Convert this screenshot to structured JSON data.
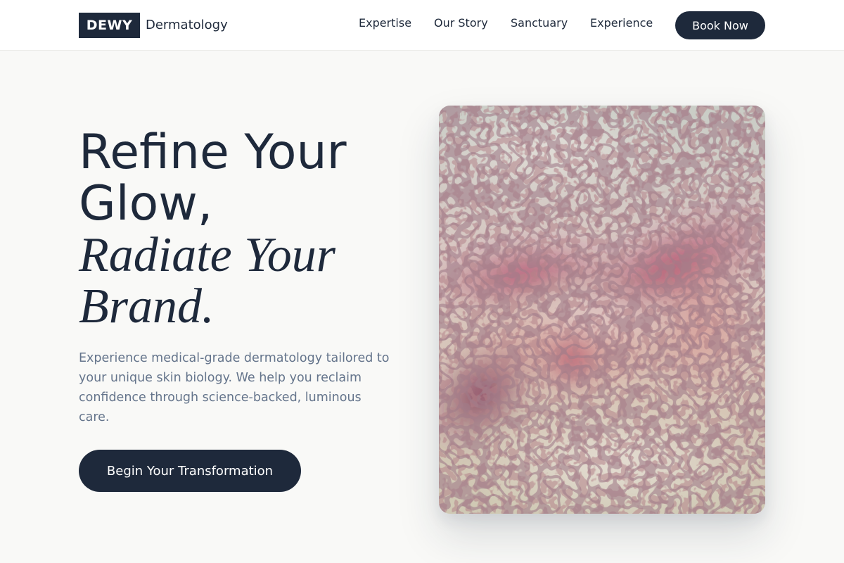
{
  "header": {
    "logo_mark": "DEWY",
    "logo_text": "Dermatology",
    "nav": [
      "Expertise",
      "Our Story",
      "Sanctuary",
      "Experience"
    ],
    "cta": "Book Now"
  },
  "hero": {
    "title_line1": "Refine Your",
    "title_line2": "Glow,",
    "title_line3": "Radiate Your",
    "title_line4": "Brand.",
    "description": "Experience medical-grade dermatology tailored to your unique skin biology. We help you reclaim confidence through science-backed, luminous care.",
    "cta": "Begin Your Transformation",
    "image": "cracked-skin-texture-image"
  },
  "colors": {
    "primary": "#1e293b",
    "background": "#f9f9f7",
    "muted_text": "#64748b"
  }
}
